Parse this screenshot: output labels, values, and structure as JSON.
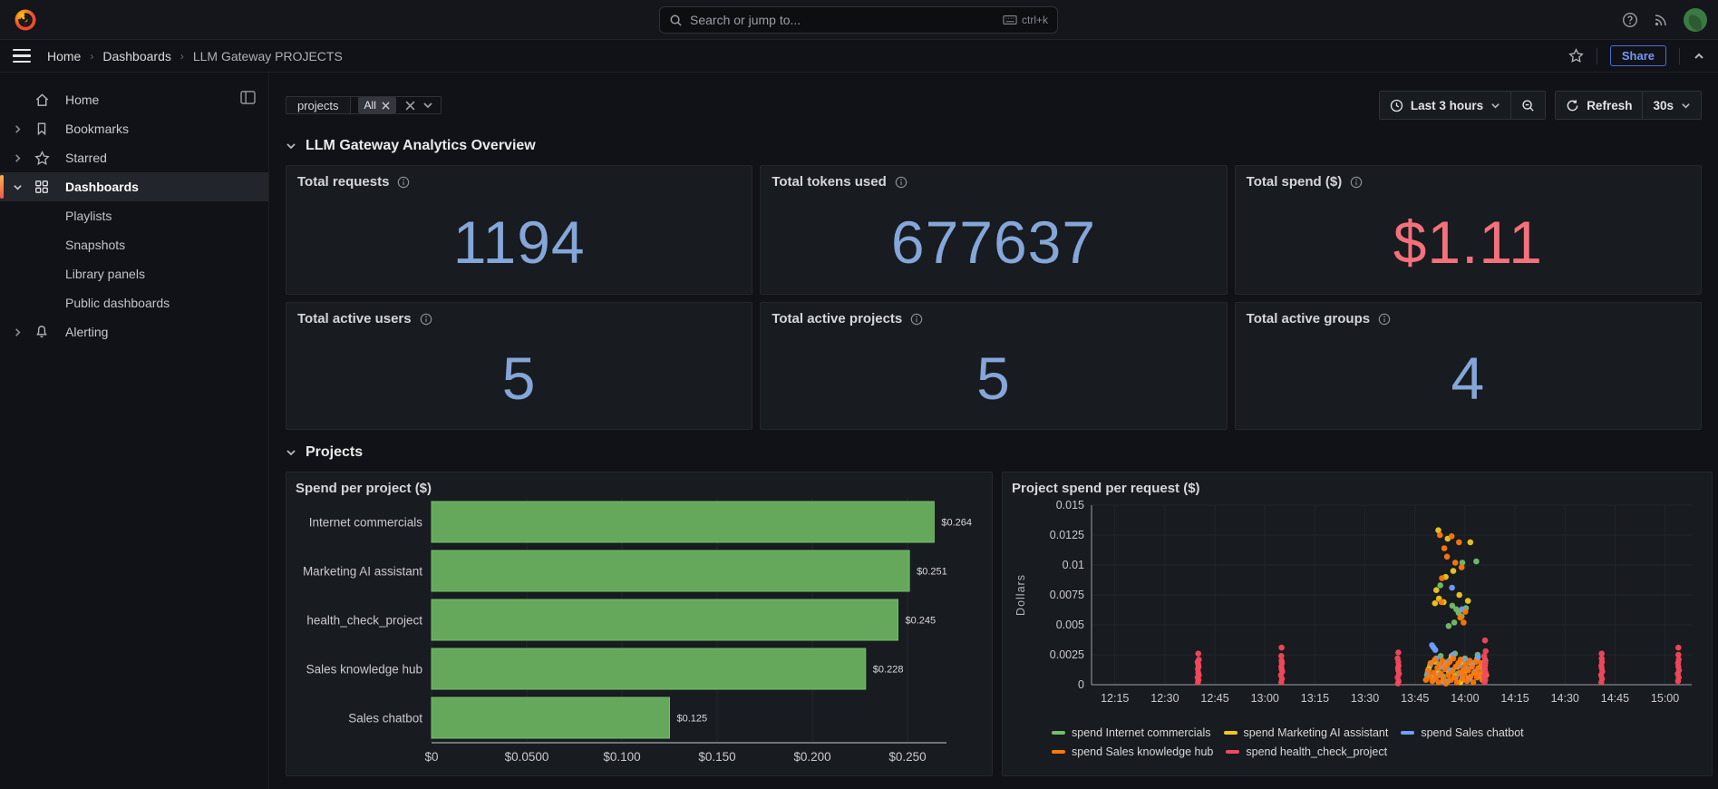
{
  "header": {
    "search_placeholder": "Search or jump to...",
    "shortcut": "ctrl+k"
  },
  "breadcrumb": {
    "home": "Home",
    "dashboards": "Dashboards",
    "current": "LLM Gateway PROJECTS",
    "share": "Share"
  },
  "sidebar": {
    "items": [
      {
        "label": "Home"
      },
      {
        "label": "Bookmarks"
      },
      {
        "label": "Starred"
      },
      {
        "label": "Dashboards"
      },
      {
        "label": "Playlists"
      },
      {
        "label": "Snapshots"
      },
      {
        "label": "Library panels"
      },
      {
        "label": "Public dashboards"
      },
      {
        "label": "Alerting"
      }
    ]
  },
  "toolbar": {
    "filter_name": "projects",
    "filter_value": "All",
    "time_range": "Last 3 hours",
    "refresh": "Refresh",
    "interval": "30s"
  },
  "sections": {
    "overview": "LLM Gateway Analytics Overview",
    "projects": "Projects"
  },
  "stats": [
    {
      "title": "Total requests",
      "value": "1194",
      "color": "#84A6D8"
    },
    {
      "title": "Total tokens used",
      "value": "677637",
      "color": "#84A6D8"
    },
    {
      "title": "Total spend ($)",
      "value": "$1.11",
      "color": "#F3717B"
    },
    {
      "title": "Total active users",
      "value": "5",
      "color": "#84A6D8"
    },
    {
      "title": "Total active projects",
      "value": "5",
      "color": "#84A6D8"
    },
    {
      "title": "Total active groups",
      "value": "4",
      "color": "#84A6D8"
    }
  ],
  "chart_data": [
    {
      "type": "bar",
      "orientation": "horizontal",
      "title": "Spend per project ($)",
      "categories": [
        "Internet commercials",
        "Marketing AI assistant",
        "health_check_project",
        "Sales knowledge hub",
        "Sales chatbot"
      ],
      "values": [
        0.264,
        0.251,
        0.245,
        0.228,
        0.125
      ],
      "value_labels": [
        "$0.264",
        "$0.251",
        "$0.245",
        "$0.228",
        "$0.125"
      ],
      "xlim": [
        0,
        0.285
      ],
      "x_ticks": [
        0,
        0.05,
        0.1,
        0.15,
        0.2,
        0.25
      ],
      "x_tick_labels": [
        "$0",
        "$0.0500",
        "$0.100",
        "$0.150",
        "$0.200",
        "$0.250"
      ],
      "bar_color": "#65A85C",
      "bar_border_color": "#73BF69",
      "grid": true
    },
    {
      "type": "scatter",
      "title": "Project spend per request ($)",
      "ylabel": "Dollars",
      "x_unit": "minutes after 12:00",
      "xlim": [
        8,
        188
      ],
      "x_ticks": [
        15,
        30,
        45,
        60,
        75,
        90,
        105,
        120,
        135,
        150,
        165,
        180
      ],
      "x_tick_labels": [
        "12:15",
        "12:30",
        "12:45",
        "13:00",
        "13:15",
        "13:30",
        "13:45",
        "14:00",
        "14:15",
        "14:30",
        "14:45",
        "15:00"
      ],
      "ylim": [
        0,
        0.015
      ],
      "y_ticks": [
        0,
        0.0025,
        0.005,
        0.0075,
        0.01,
        0.0125,
        0.015
      ],
      "y_tick_labels": [
        "0",
        "0.0025",
        "0.005",
        "0.0075",
        "0.01",
        "0.0125",
        "0.015"
      ],
      "legend_position": "bottom",
      "grid": true,
      "series": [
        {
          "name": "spend Internet commercials",
          "color": "#73BF69",
          "points": [
            [
              108.6,
              0.0008
            ],
            [
              109.5,
              0.0016
            ],
            [
              110.4,
              0.0005
            ],
            [
              111.2,
              0.0019
            ],
            [
              112.0,
              0.0011
            ],
            [
              112.7,
              0.0024
            ],
            [
              113.4,
              0.0007
            ],
            [
              114.1,
              0.0015
            ],
            [
              114.9,
              0.0003
            ],
            [
              115.6,
              0.0021
            ],
            [
              116.3,
              0.0012
            ],
            [
              117.0,
              0.0026
            ],
            [
              117.8,
              0.0009
            ],
            [
              118.5,
              0.0017
            ],
            [
              119.3,
              0.0004
            ],
            [
              120.0,
              0.0022
            ],
            [
              120.8,
              0.0013
            ],
            [
              121.5,
              0.0006
            ],
            [
              122.3,
              0.0018
            ],
            [
              123.0,
              0.001
            ],
            [
              123.8,
              0.0025
            ],
            [
              124.5,
              0.0014
            ],
            [
              125.3,
              0.0007
            ],
            [
              126.1,
              0.002
            ],
            [
              112.6,
              0.0083
            ],
            [
              119.2,
              0.0102
            ],
            [
              123.4,
              0.0103
            ],
            [
              116.2,
              0.0066
            ],
            [
              117.4,
              0.0063
            ],
            [
              118.1,
              0.006
            ],
            [
              119.0,
              0.0057
            ],
            [
              120.3,
              0.0064
            ],
            [
              116.8,
              0.0052
            ],
            [
              115.1,
              0.0049
            ]
          ]
        },
        {
          "name": "spend Marketing AI assistant",
          "color": "#EFC821",
          "points": [
            [
              109.1,
              0.0013
            ],
            [
              110.0,
              0.0006
            ],
            [
              110.9,
              0.002
            ],
            [
              111.8,
              0.0009
            ],
            [
              112.6,
              0.0016
            ],
            [
              113.5,
              0.0003
            ],
            [
              114.4,
              0.0018
            ],
            [
              115.2,
              0.0011
            ],
            [
              116.0,
              0.0024
            ],
            [
              116.9,
              0.0007
            ],
            [
              117.7,
              0.0015
            ],
            [
              118.6,
              0.0002
            ],
            [
              119.4,
              0.0019
            ],
            [
              120.3,
              0.0012
            ],
            [
              121.1,
              0.0005
            ],
            [
              122.0,
              0.0017
            ],
            [
              122.8,
              0.001
            ],
            [
              123.7,
              0.0022
            ],
            [
              124.6,
              0.0008
            ],
            [
              125.4,
              0.0015
            ],
            [
              112.0,
              0.0129
            ],
            [
              114.8,
              0.0122
            ],
            [
              121.6,
              0.0119
            ],
            [
              116.5,
              0.0095
            ],
            [
              114.2,
              0.009
            ],
            [
              111.4,
              0.0079
            ],
            [
              112.2,
              0.0072
            ],
            [
              113.6,
              0.0069
            ],
            [
              120.9,
              0.007
            ],
            [
              111.0,
              0.0068
            ],
            [
              118.3,
              0.0075
            ]
          ]
        },
        {
          "name": "spend Sales chatbot",
          "color": "#6E9FFF",
          "points": [
            [
              108.8,
              0.001
            ],
            [
              109.7,
              0.0018
            ],
            [
              110.5,
              0.0004
            ],
            [
              111.4,
              0.0022
            ],
            [
              112.2,
              0.0008
            ],
            [
              113.0,
              0.0015
            ],
            [
              113.9,
              0.0002
            ],
            [
              114.7,
              0.0019
            ],
            [
              115.5,
              0.0012
            ],
            [
              116.4,
              0.0025
            ],
            [
              117.2,
              0.0006
            ],
            [
              118.0,
              0.0016
            ],
            [
              118.9,
              0.0009
            ],
            [
              119.7,
              0.0021
            ],
            [
              120.5,
              0.0013
            ],
            [
              121.3,
              0.0005
            ],
            [
              122.2,
              0.0017
            ],
            [
              123.1,
              0.0011
            ],
            [
              123.9,
              0.0023
            ],
            [
              124.7,
              0.0007
            ],
            [
              125.5,
              0.0014
            ],
            [
              110.1,
              0.0033
            ],
            [
              110.6,
              0.0031
            ],
            [
              111.1,
              0.0029
            ],
            [
              116.1,
              0.0081
            ],
            [
              119.1,
              0.0063
            ]
          ]
        },
        {
          "name": "spend Sales knowledge hub",
          "color": "#FF780A",
          "points": [
            [
              108.3,
              0.0004
            ],
            [
              108.9,
              0.0012
            ],
            [
              109.4,
              0.0007
            ],
            [
              109.8,
              0.0018
            ],
            [
              110.2,
              0.0003
            ],
            [
              110.6,
              0.001
            ],
            [
              111.0,
              0.0021
            ],
            [
              111.3,
              0.0006
            ],
            [
              111.7,
              0.0014
            ],
            [
              112.1,
              0.0002
            ],
            [
              112.4,
              0.0017
            ],
            [
              112.8,
              0.0009
            ],
            [
              113.2,
              0.002
            ],
            [
              113.5,
              0.0005
            ],
            [
              113.9,
              0.0013
            ],
            [
              114.3,
              0.0001
            ],
            [
              114.6,
              0.0016
            ],
            [
              115.0,
              0.0008
            ],
            [
              115.4,
              0.0019
            ],
            [
              115.8,
              0.0004
            ],
            [
              116.1,
              0.0011
            ],
            [
              116.5,
              0.0022
            ],
            [
              116.9,
              0.0006
            ],
            [
              117.2,
              0.0015
            ],
            [
              117.6,
              0.0002
            ],
            [
              118.0,
              0.0018
            ],
            [
              118.4,
              0.001
            ],
            [
              118.7,
              0.0021
            ],
            [
              119.1,
              0.0005
            ],
            [
              119.5,
              0.0013
            ],
            [
              119.9,
              0.0008
            ],
            [
              120.2,
              0.0017
            ],
            [
              120.6,
              0.0003
            ],
            [
              121.0,
              0.0012
            ],
            [
              121.4,
              0.002
            ],
            [
              121.7,
              0.0007
            ],
            [
              122.1,
              0.0015
            ],
            [
              122.5,
              0.0002
            ],
            [
              122.9,
              0.001
            ],
            [
              123.2,
              0.0019
            ],
            [
              123.6,
              0.0006
            ],
            [
              124.0,
              0.0014
            ],
            [
              124.4,
              0.0009
            ],
            [
              124.8,
              0.0018
            ],
            [
              125.2,
              0.0004
            ],
            [
              125.6,
              0.0012
            ],
            [
              126.0,
              0.0016
            ],
            [
              126.4,
              0.0008
            ],
            [
              112.5,
              0.0125
            ],
            [
              116.0,
              0.0124
            ],
            [
              118.2,
              0.0119
            ],
            [
              113.8,
              0.0114
            ],
            [
              114.6,
              0.0107
            ],
            [
              117.1,
              0.0102
            ],
            [
              119.0,
              0.0098
            ],
            [
              113.1,
              0.0089
            ],
            [
              120.1,
              0.0061
            ],
            [
              118.6,
              0.0056
            ],
            [
              119.6,
              0.0052
            ],
            [
              112.9,
              0.0069
            ]
          ]
        },
        {
          "name": "spend health_check_project",
          "color": "#F2495C",
          "points": [
            [
              39.9,
              0.0002
            ],
            [
              40.1,
              0.0004
            ],
            [
              39.8,
              0.0006
            ],
            [
              40.2,
              0.0008
            ],
            [
              40.0,
              0.001
            ],
            [
              39.9,
              0.0013
            ],
            [
              40.1,
              0.0015
            ],
            [
              40.0,
              0.0017
            ],
            [
              39.8,
              0.0019
            ],
            [
              40.2,
              0.0021
            ],
            [
              40.0,
              0.0026
            ],
            [
              64.9,
              0.0002
            ],
            [
              65.1,
              0.0005
            ],
            [
              64.8,
              0.0008
            ],
            [
              65.2,
              0.0011
            ],
            [
              65.0,
              0.0013
            ],
            [
              64.9,
              0.0015
            ],
            [
              65.1,
              0.0018
            ],
            [
              65.0,
              0.002
            ],
            [
              64.9,
              0.0024
            ],
            [
              65.0,
              0.0031
            ],
            [
              99.9,
              0.0001
            ],
            [
              100.1,
              0.0003
            ],
            [
              99.8,
              0.0006
            ],
            [
              100.2,
              0.0009
            ],
            [
              100.0,
              0.0012
            ],
            [
              99.9,
              0.0014
            ],
            [
              100.1,
              0.0016
            ],
            [
              100.0,
              0.0019
            ],
            [
              99.8,
              0.0022
            ],
            [
              100.0,
              0.0027
            ],
            [
              125.9,
              0.0002
            ],
            [
              126.1,
              0.0004
            ],
            [
              125.8,
              0.0007
            ],
            [
              126.2,
              0.001
            ],
            [
              126.0,
              0.0013
            ],
            [
              125.9,
              0.0016
            ],
            [
              126.1,
              0.0018
            ],
            [
              126.0,
              0.0021
            ],
            [
              125.8,
              0.0024
            ],
            [
              126.2,
              0.0028
            ],
            [
              126.0,
              0.0037
            ],
            [
              160.9,
              0.0002
            ],
            [
              161.1,
              0.0005
            ],
            [
              160.8,
              0.0008
            ],
            [
              161.2,
              0.0011
            ],
            [
              161.0,
              0.0014
            ],
            [
              160.9,
              0.0016
            ],
            [
              161.1,
              0.0019
            ],
            [
              161.0,
              0.0022
            ],
            [
              161.0,
              0.0026
            ],
            [
              183.9,
              0.0003
            ],
            [
              184.1,
              0.0006
            ],
            [
              183.8,
              0.0009
            ],
            [
              184.2,
              0.0012
            ],
            [
              184.0,
              0.0015
            ],
            [
              183.9,
              0.0018
            ],
            [
              184.1,
              0.0021
            ],
            [
              184.0,
              0.0025
            ],
            [
              184.0,
              0.0031
            ]
          ]
        }
      ]
    }
  ]
}
